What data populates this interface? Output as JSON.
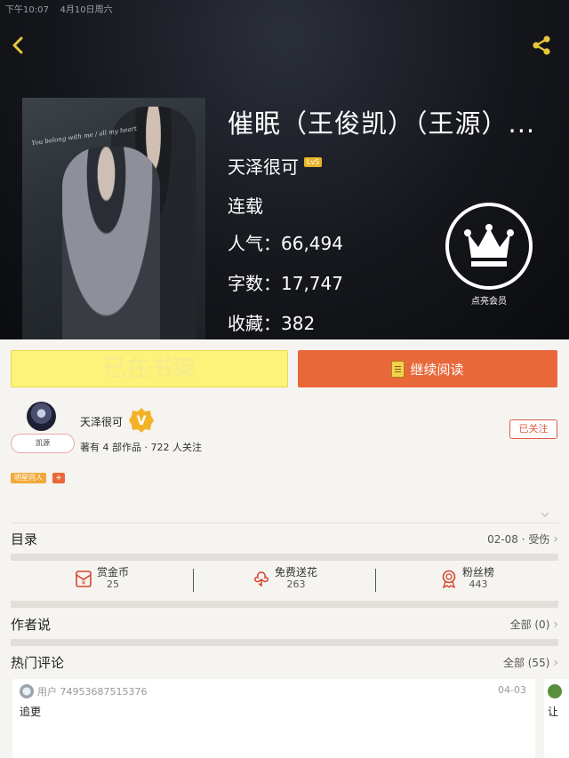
{
  "status_bar": {
    "time": "下午10:07",
    "date": "4月10日周六"
  },
  "book": {
    "title": "催眠（王俊凯）（王源）...",
    "author": "天泽很可",
    "level": "Lv5",
    "status": "连载",
    "popularity": "人气：66,494",
    "words": "字数：17,747",
    "favorites": "收藏：382",
    "cover_text": "You belong with me / all my heart",
    "vip_label": "点亮会员"
  },
  "actions": {
    "shelf": "已在书架",
    "read": "继续阅读"
  },
  "writer": {
    "name": "天泽很可",
    "avatar_tag": "凯源",
    "meta": "著有 4 部作品 · 722 人关注",
    "follow": "已关注"
  },
  "tags": {
    "chip": "明星同人",
    "add": "+"
  },
  "toc": {
    "title": "目录",
    "latest": "02-08 · 受伤",
    "chev": "›"
  },
  "perks": [
    {
      "label": "赏金币",
      "value": "25"
    },
    {
      "label": "免费送花",
      "value": "263"
    },
    {
      "label": "粉丝榜",
      "value": "443"
    }
  ],
  "author_says": {
    "title": "作者说",
    "link": "全部 (0)",
    "chev": "›"
  },
  "hot_comments": {
    "title": "热门评论",
    "link": "全部 (55)",
    "chev": "›",
    "items": [
      {
        "user": "用户 74953687515376",
        "date": "04-03",
        "text": "追更"
      },
      {
        "text": "让"
      }
    ]
  },
  "colors": {
    "accent": "#e9683a",
    "shelf_bg": "#fdf27a",
    "follow": "#e35b49",
    "tag": "#f2a93b"
  }
}
